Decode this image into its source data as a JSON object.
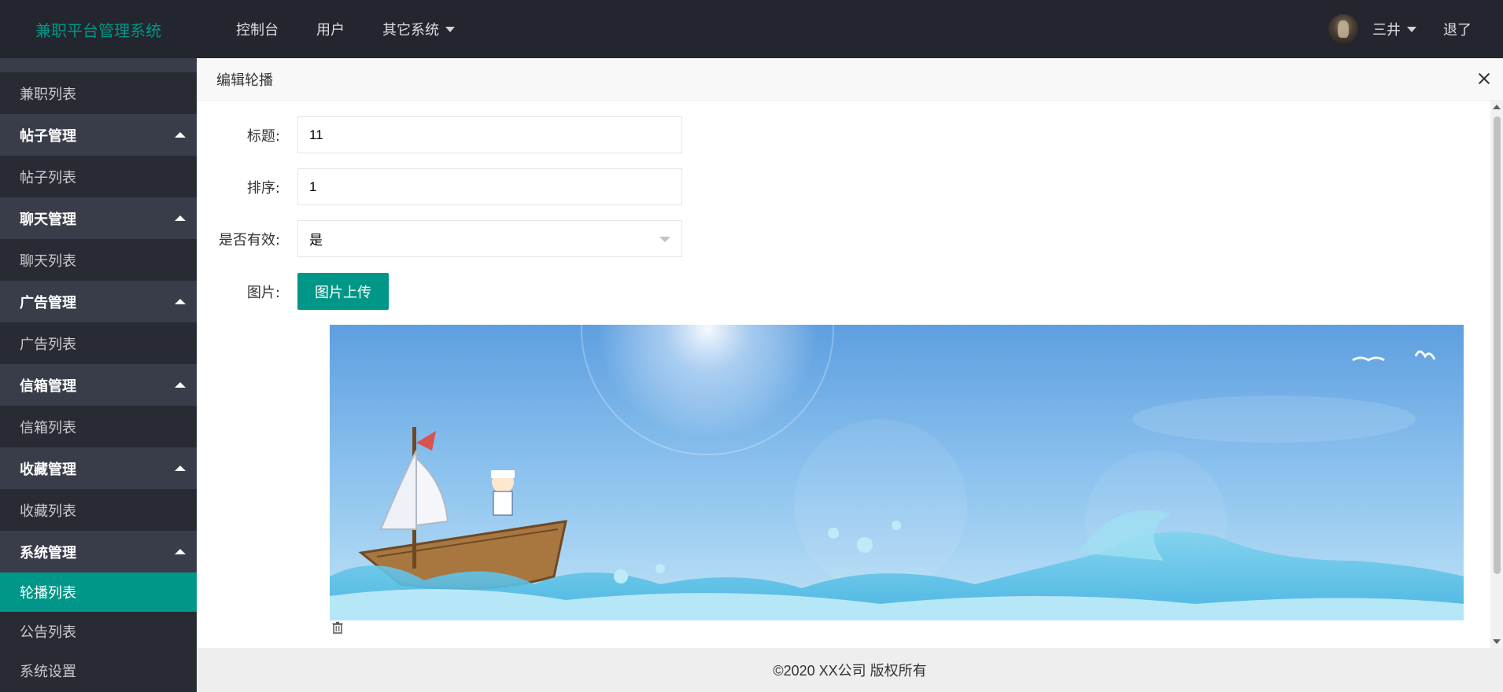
{
  "header": {
    "logo": "兼职平台管理系统",
    "nav": [
      "控制台",
      "用户",
      "其它系统"
    ],
    "user_name": "三井",
    "logout": "退了"
  },
  "sidebar": {
    "items": [
      {
        "label": "兼职列表",
        "type": "item"
      },
      {
        "label": "帖子管理",
        "type": "group"
      },
      {
        "label": "帖子列表",
        "type": "item"
      },
      {
        "label": "聊天管理",
        "type": "group"
      },
      {
        "label": "聊天列表",
        "type": "item"
      },
      {
        "label": "广告管理",
        "type": "group"
      },
      {
        "label": "广告列表",
        "type": "item"
      },
      {
        "label": "信箱管理",
        "type": "group"
      },
      {
        "label": "信箱列表",
        "type": "item"
      },
      {
        "label": "收藏管理",
        "type": "group"
      },
      {
        "label": "收藏列表",
        "type": "item"
      },
      {
        "label": "系统管理",
        "type": "group"
      },
      {
        "label": "轮播列表",
        "type": "item",
        "active": true
      },
      {
        "label": "公告列表",
        "type": "item"
      },
      {
        "label": "系统设置",
        "type": "item"
      }
    ]
  },
  "panel": {
    "title": "编辑轮播",
    "fields": {
      "title_label": "标题:",
      "title_value": "11",
      "sort_label": "排序:",
      "sort_value": "1",
      "valid_label": "是否有效:",
      "valid_value": "是",
      "image_label": "图片:",
      "upload_button": "图片上传"
    }
  },
  "footer": {
    "text": "©2020 XX公司 版权所有"
  },
  "colors": {
    "accent": "#009688",
    "header_bg": "#23262e",
    "sidebar_bg": "#282b33",
    "sidebar_group_bg": "#393d49"
  }
}
